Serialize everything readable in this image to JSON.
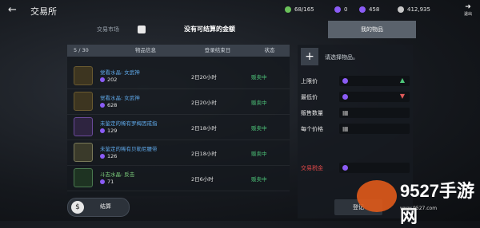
{
  "header": {
    "title": "交易所",
    "resources": [
      {
        "value": "68/165",
        "color": "#6ac15a"
      },
      {
        "value": "0",
        "color": "#8b5cf6"
      },
      {
        "value": "458",
        "color": "#8b5cf6"
      },
      {
        "value": "412,935",
        "color": "#c8c8c8"
      }
    ],
    "exit_label": "退出"
  },
  "tabs": [
    {
      "label": "交易市场",
      "active": false
    },
    {
      "label": "我的物品",
      "active": true
    }
  ],
  "notice": "没有可结算的金额",
  "list": {
    "count": "5 / 30",
    "columns": [
      "物品信息",
      "登录结束日",
      "状态"
    ],
    "rows": [
      {
        "name": "觉看水晶: 女武神",
        "price": "202",
        "time": "2日20小时",
        "status": "贩卖中"
      },
      {
        "name": "觉看水晶: 女武神",
        "price": "628",
        "time": "2日20小时",
        "status": "贩卖中"
      },
      {
        "name": "未鉴定的稀有罗梅因戒指",
        "price": "129",
        "time": "2日18小时",
        "status": "贩卖中"
      },
      {
        "name": "未鉴定的稀有贝勒尼腰带",
        "price": "126",
        "time": "2日18小时",
        "status": "贩卖中"
      },
      {
        "name": "斗志水晶: 反击",
        "price": "71",
        "time": "2日6小时",
        "status": "贩卖中"
      }
    ]
  },
  "settle_label": "结算",
  "right": {
    "select_text": "请选择物品。",
    "fields": [
      "上限价",
      "最低价",
      "贩售数量",
      "每个价格"
    ],
    "tax_label": "交易税金",
    "register_label": "登记"
  },
  "watermark": {
    "text": "9527手游网",
    "url": "www.9527.com"
  }
}
